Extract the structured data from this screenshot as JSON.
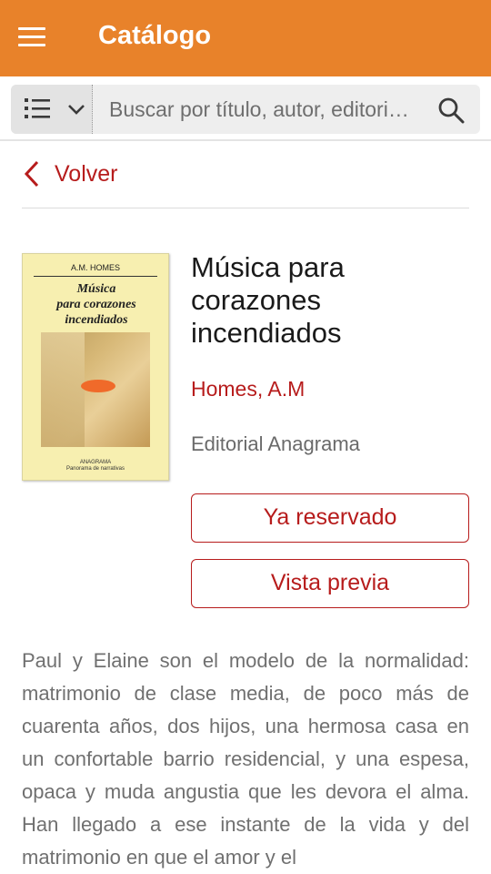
{
  "appbar": {
    "title": "Catálogo",
    "menu_icon": "hamburger-menu-icon"
  },
  "search": {
    "placeholder": "Buscar por título, autor, editori…",
    "value": "",
    "view_icon": "list-view-icon",
    "dropdown_icon": "chevron-down-icon",
    "search_icon": "search-icon"
  },
  "nav": {
    "back_label": "Volver",
    "back_icon": "chevron-left-icon"
  },
  "book": {
    "title": "Música para corazones incendiados",
    "author": "Homes, A.M",
    "publisher": "Editorial Anagrama",
    "cover": {
      "author": "A.M. HOMES",
      "title_line1": "Música",
      "title_line2": "para corazones",
      "title_line3": "incendiados",
      "publisher": "ANAGRAMA",
      "collection": "Panorama de narrativas"
    },
    "description": "Paul y Elaine son el modelo de la normalidad: matrimonio de clase media, de poco más de cuarenta años, dos hijos, una hermosa casa en un confortable barrio residencial, y una espesa, opaca y muda angustia que les devora el alma. Han llegado a ese instante de la vida y del matrimonio en que el amor y el"
  },
  "actions": {
    "reserve_label": "Ya reservado",
    "preview_label": "Vista previa"
  },
  "colors": {
    "appbar": "#e8822a",
    "accent": "#b71c1c",
    "muted_text": "#707070"
  }
}
